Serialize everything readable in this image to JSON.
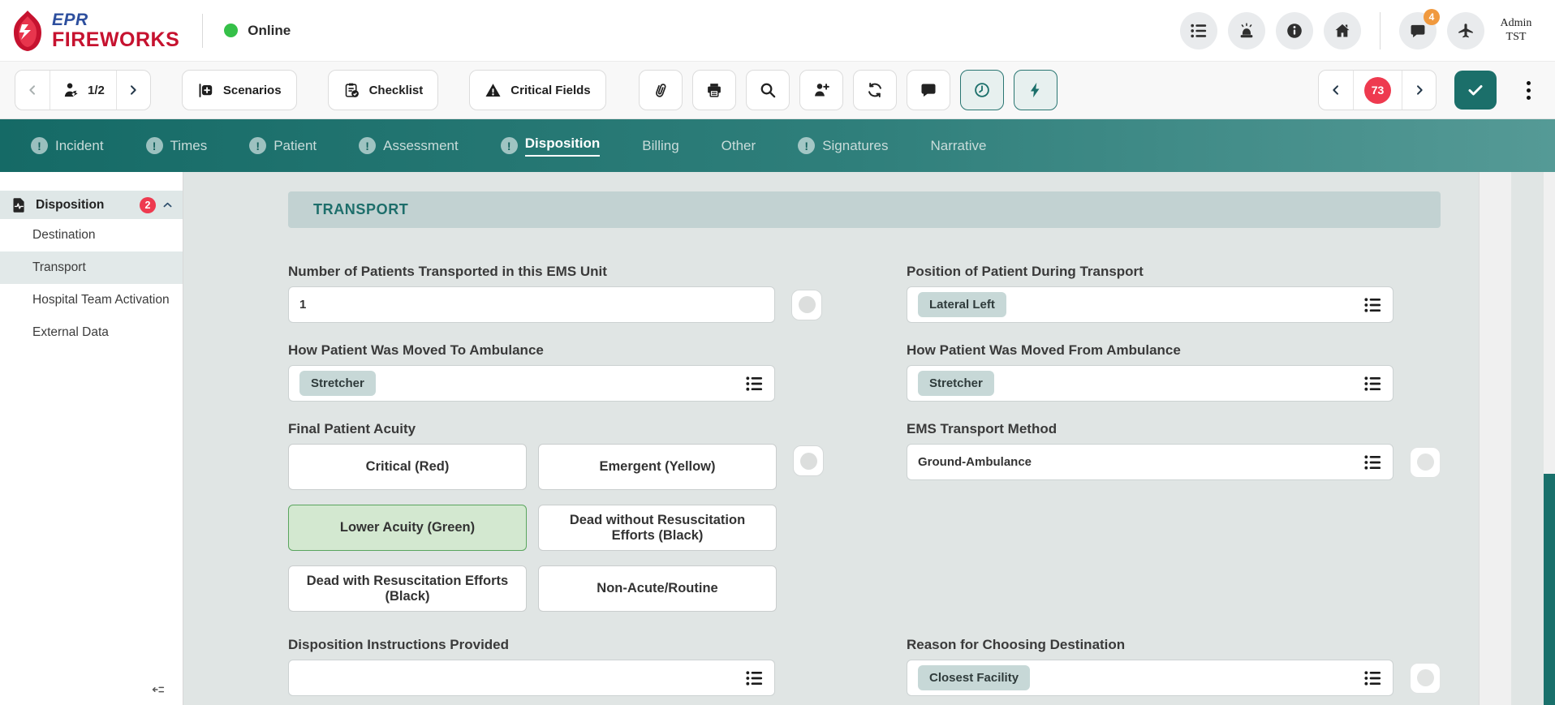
{
  "app": {
    "brand_top": "EPR",
    "brand_bottom": "FIREWORKS",
    "status": "Online",
    "user_line1": "Admin",
    "user_line2": "TST",
    "chat_badge": "4"
  },
  "header_icons": [
    "menu-list",
    "siren",
    "info",
    "home",
    "chat",
    "airplane"
  ],
  "toolbar": {
    "record_pager": "1/2",
    "scenarios": "Scenarios",
    "checklist": "Checklist",
    "critical_fields": "Critical Fields",
    "icon_buttons": [
      "attachment",
      "print",
      "search",
      "add-crew",
      "sync",
      "comment",
      "time",
      "quick-actions"
    ],
    "issue_count": "73"
  },
  "tabs": [
    {
      "label": "Incident",
      "alert": true,
      "active": false
    },
    {
      "label": "Times",
      "alert": true,
      "active": false
    },
    {
      "label": "Patient",
      "alert": true,
      "active": false
    },
    {
      "label": "Assessment",
      "alert": true,
      "active": false
    },
    {
      "label": "Disposition",
      "alert": true,
      "active": true
    },
    {
      "label": "Billing",
      "alert": false,
      "active": false
    },
    {
      "label": "Other",
      "alert": false,
      "active": false
    },
    {
      "label": "Signatures",
      "alert": true,
      "active": false
    },
    {
      "label": "Narrative",
      "alert": false,
      "active": false
    }
  ],
  "sidebar": {
    "section_label": "Disposition",
    "section_badge": "2",
    "items": [
      {
        "label": "Destination",
        "active": false
      },
      {
        "label": "Transport",
        "active": true
      },
      {
        "label": "Hospital Team Activation",
        "active": false
      },
      {
        "label": "External Data",
        "active": false
      }
    ]
  },
  "transport_form": {
    "section_title": "TRANSPORT",
    "num_patients_label": "Number of Patients Transported in this EMS Unit",
    "num_patients_value": "1",
    "position_label": "Position of Patient During Transport",
    "position_value": "Lateral Left",
    "moved_to_label": "How Patient Was Moved To Ambulance",
    "moved_to_value": "Stretcher",
    "moved_from_label": "How Patient Was Moved From Ambulance",
    "moved_from_value": "Stretcher",
    "acuity_label": "Final Patient Acuity",
    "acuity_options": [
      "Critical (Red)",
      "Emergent (Yellow)",
      "Lower Acuity (Green)",
      "Dead without Resuscitation Efforts (Black)",
      "Dead with Resuscitation Efforts (Black)",
      "Non-Acute/Routine"
    ],
    "acuity_selected": "Lower Acuity (Green)",
    "transport_method_label": "EMS Transport Method",
    "transport_method_value": "Ground-Ambulance",
    "instructions_label": "Disposition Instructions Provided",
    "instructions_value": "",
    "reason_label": "Reason for Choosing Destination",
    "reason_value": "Closest Facility"
  },
  "colors": {
    "teal": "#1b6f6a",
    "red_badge": "#ee3a4f",
    "orange_badge": "#f0993e",
    "selected_green_bg": "#d3e8d0",
    "selected_green_border": "#5aa55e",
    "brand_blue": "#2d4f9e",
    "brand_red": "#c6122f",
    "online_green": "#35c048"
  }
}
